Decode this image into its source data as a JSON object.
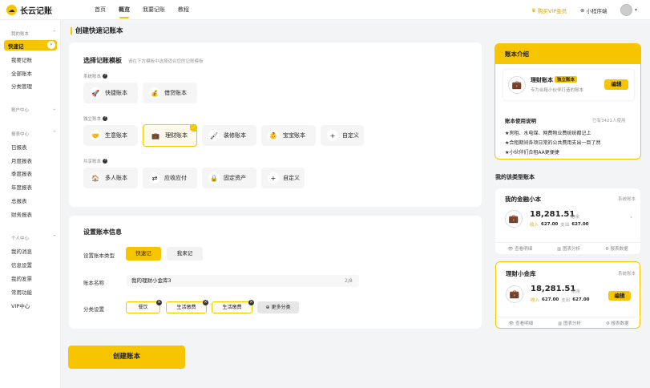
{
  "app": {
    "name": "长云记账"
  },
  "nav": [
    "首页",
    "概览",
    "我要记账",
    "教程"
  ],
  "header": {
    "vip": "购买VIP会员",
    "mini": "小程序端"
  },
  "sidebar": {
    "groups": [
      "我的账本",
      "账户中心",
      "报表中心",
      "个人中心"
    ],
    "book_items": [
      "快速记",
      "我要记账",
      "全部账本",
      "分类管理"
    ],
    "report_items": [
      "日报表",
      "月度报表",
      "季度报表",
      "年度报表",
      "总报表",
      "财务报表"
    ],
    "personal_items": [
      "我的消息",
      "信息设置",
      "我的发票",
      "常用功能",
      "VIP中心"
    ]
  },
  "page": {
    "title": "创建快速记账本"
  },
  "template": {
    "title": "选择记账模板",
    "hint": "请在下方模板中选择适合您的记账模板",
    "system_label": "系统账本",
    "system": [
      "快捷账本",
      "借贷账本"
    ],
    "independent_label": "独立账本",
    "independent": [
      "生意账本",
      "理财账本",
      "装修账本",
      "宝宝账本",
      "自定义"
    ],
    "shared_label": "共享账本",
    "shared": [
      "多人账本",
      "应收应付",
      "固定资产",
      "自定义"
    ]
  },
  "settings": {
    "title": "设置账本信息",
    "type_label": "设置账本类型",
    "type_options": [
      "快速记",
      "我来记"
    ],
    "name_label": "账本名称",
    "name_value": "我的理财小金库3",
    "name_count": "2/8",
    "cat_label": "分类设置",
    "categories": [
      "餐饮",
      "生活缴费",
      "生活缴费"
    ],
    "more": "更多分类"
  },
  "create_button": "创建账本",
  "intro": {
    "title": "账本介绍",
    "book_name": "理财账本",
    "badge": "独立账本",
    "desc": "专为合租小伙伴打造的账本",
    "edit": "编辑",
    "usage_title": "账本使用说明",
    "usage_count": "已有3421人使用",
    "lines": [
      "★房租、水电煤、网费物业费统统都记上",
      "★合租期间各项日常的公共费用支出一目了然",
      "★小伙伴们合租AA更便捷"
    ]
  },
  "my_books": {
    "title": "我的该类型账本",
    "cards": [
      {
        "name": "我的金融小本",
        "type": "系统账本",
        "amount": "18,281.51",
        "unit": "结余",
        "in_label": "收入",
        "in": "627.00",
        "out_label": "支出",
        "out": "627.00",
        "actions": [
          "查看明细",
          "图表分析",
          "报表数据"
        ]
      },
      {
        "name": "理财小金库",
        "type": "系统账本",
        "amount": "18,281.51",
        "unit": "结余",
        "in_label": "收入",
        "in": "627.00",
        "out_label": "支出",
        "out": "627.00",
        "edit": "编辑",
        "actions": [
          "查看明细",
          "图表分析",
          "报表数据"
        ]
      }
    ]
  }
}
